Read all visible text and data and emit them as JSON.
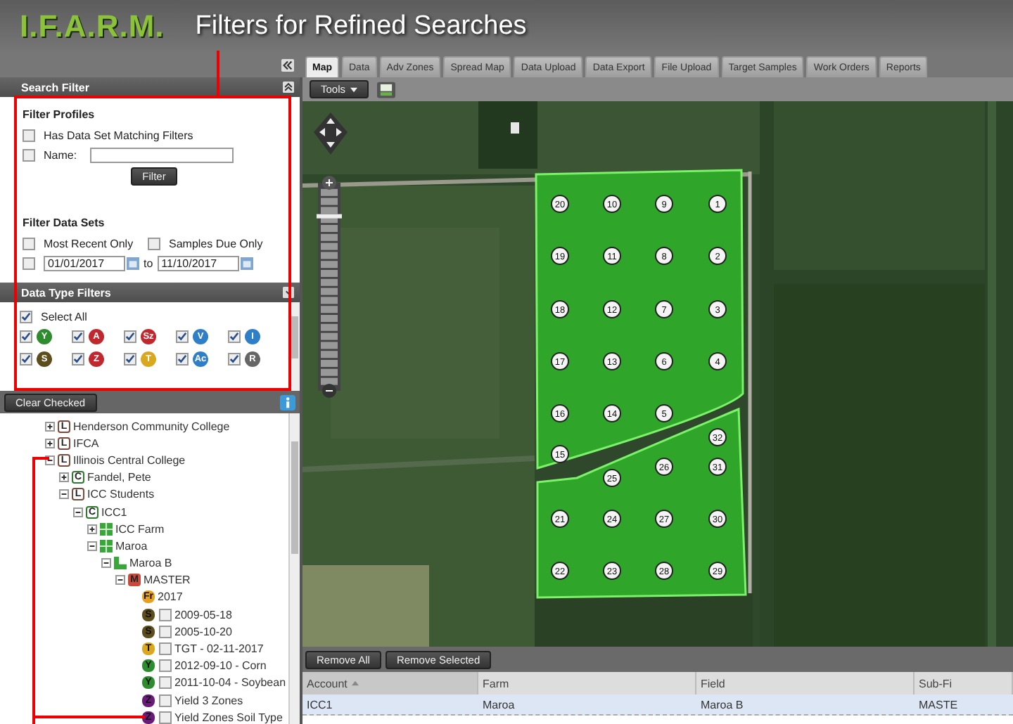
{
  "header": {
    "logo": "I.F.A.R.M.",
    "title": "Filters for Refined Searches"
  },
  "tabs": [
    {
      "label": "Map",
      "selected": true
    },
    {
      "label": "Data",
      "selected": false
    },
    {
      "label": "Adv Zones",
      "selected": false
    },
    {
      "label": "Spread Map",
      "selected": false
    },
    {
      "label": "Data Upload",
      "selected": false
    },
    {
      "label": "Data Export",
      "selected": false
    },
    {
      "label": "File Upload",
      "selected": false
    },
    {
      "label": "Target Samples",
      "selected": false
    },
    {
      "label": "Work Orders",
      "selected": false
    },
    {
      "label": "Reports",
      "selected": false
    }
  ],
  "search_filter": {
    "title": "Search Filter",
    "profiles": {
      "heading": "Filter Profiles",
      "has_data_set": {
        "label": "Has Data Set Matching Filters",
        "checked": false
      },
      "name": {
        "label": "Name:",
        "checked": false
      },
      "button": "Filter"
    },
    "data_sets": {
      "heading": "Filter Data Sets",
      "most_recent": {
        "label": "Most Recent Only",
        "checked": false
      },
      "samples_due": {
        "label": "Samples Due Only",
        "checked": false
      },
      "date_range": {
        "checked": false,
        "from": "01/01/2017",
        "joiner": "to",
        "to": "11/10/2017"
      }
    }
  },
  "data_type_filters": {
    "title": "Data Type Filters",
    "select_all": {
      "label": "Select All",
      "checked": true
    },
    "types": [
      {
        "letter": "Y",
        "color": "#2e8b2e",
        "checked": true
      },
      {
        "letter": "A",
        "color": "#c0282d",
        "checked": true
      },
      {
        "letter": "Sz",
        "color": "#c0282d",
        "checked": true
      },
      {
        "letter": "V",
        "color": "#2f7fc8",
        "checked": true
      },
      {
        "letter": "I",
        "color": "#2f7fc8",
        "checked": true
      },
      {
        "letter": "S",
        "color": "#5e4d1c",
        "checked": true
      },
      {
        "letter": "Z",
        "color": "#c0282d",
        "checked": true
      },
      {
        "letter": "T",
        "color": "#d9a81e",
        "checked": true
      },
      {
        "letter": "Ac",
        "color": "#2f7fc8",
        "checked": true
      },
      {
        "letter": "R",
        "color": "#666666",
        "checked": true
      }
    ]
  },
  "tree_toolbar": {
    "button": "Clear Checked"
  },
  "tree": [
    {
      "label": "Henderson Community College",
      "kind": "group",
      "badge": "L",
      "expanded": false
    },
    {
      "label": "IFCA",
      "kind": "group",
      "badge": "L",
      "expanded": false
    },
    {
      "label": "Illinois Central College",
      "kind": "group",
      "badge": "L",
      "expanded": true,
      "children": [
        {
          "label": "Fandel, Pete",
          "kind": "client",
          "badge": "C",
          "expanded": false
        },
        {
          "label": "ICC Students",
          "kind": "group",
          "badge": "L",
          "expanded": true,
          "children": [
            {
              "label": "ICC1",
              "kind": "client",
              "badge": "C",
              "expanded": true,
              "children": [
                {
                  "label": "ICC Farm",
                  "kind": "farm",
                  "expanded": false
                },
                {
                  "label": "Maroa",
                  "kind": "farm",
                  "expanded": true,
                  "children": [
                    {
                      "label": "Maroa B",
                      "kind": "field",
                      "expanded": true,
                      "children": [
                        {
                          "label": "MASTER",
                          "kind": "subfield",
                          "badge": "M",
                          "expanded": true,
                          "children": [
                            {
                              "label": "2017",
                              "kind": "season",
                              "badge": "Fr",
                              "color": "#e8a020"
                            },
                            {
                              "label": "2009-05-18",
                              "kind": "dataset",
                              "badge": "S",
                              "color": "#5e4d1c",
                              "checked": false
                            },
                            {
                              "label": "2005-10-20",
                              "kind": "dataset",
                              "badge": "S",
                              "color": "#5e4d1c",
                              "checked": false
                            },
                            {
                              "label": "TGT - 02-11-2017",
                              "kind": "dataset",
                              "badge": "T",
                              "color": "#d9a81e",
                              "checked": false
                            },
                            {
                              "label": "2012-09-10 - Corn",
                              "kind": "dataset",
                              "badge": "Y",
                              "color": "#2e8b2e",
                              "checked": false
                            },
                            {
                              "label": "2011-10-04 - Soybean",
                              "kind": "dataset",
                              "badge": "Y",
                              "color": "#2e8b2e",
                              "checked": false
                            },
                            {
                              "label": "Yield 3 Zones",
                              "kind": "dataset",
                              "badge": "Z",
                              "color": "#6a1b7a",
                              "checked": false
                            },
                            {
                              "label": "Yield Zones Soil Type",
                              "kind": "dataset",
                              "badge": "Z",
                              "color": "#6a1b7a",
                              "checked": false
                            }
                          ]
                        }
                      ]
                    }
                  ]
                }
              ]
            }
          ]
        }
      ]
    }
  ],
  "map_toolbar": {
    "tools": "Tools"
  },
  "map": {
    "zoom_slider": {
      "level": 0.88
    },
    "sample_points": [
      "20",
      "10",
      "9",
      "1",
      "19",
      "11",
      "8",
      "2",
      "18",
      "12",
      "7",
      "3",
      "17",
      "13",
      "6",
      "4",
      "16",
      "14",
      "5",
      "15",
      "32",
      "26",
      "31",
      "25",
      "21",
      "24",
      "27",
      "30",
      "22",
      "23",
      "28",
      "29"
    ]
  },
  "grid_toolbar": {
    "buttons": [
      "Remove All",
      "Remove Selected"
    ]
  },
  "table": {
    "columns": [
      {
        "label": "Account",
        "sorted": true
      },
      {
        "label": "Farm",
        "sorted": false
      },
      {
        "label": "Field",
        "sorted": false
      },
      {
        "label": "Sub-Fi",
        "sorted": false
      }
    ],
    "rows": [
      {
        "cells": [
          "ICC1",
          "Maroa",
          "Maroa B",
          "MASTE"
        ],
        "selected": true
      }
    ]
  }
}
